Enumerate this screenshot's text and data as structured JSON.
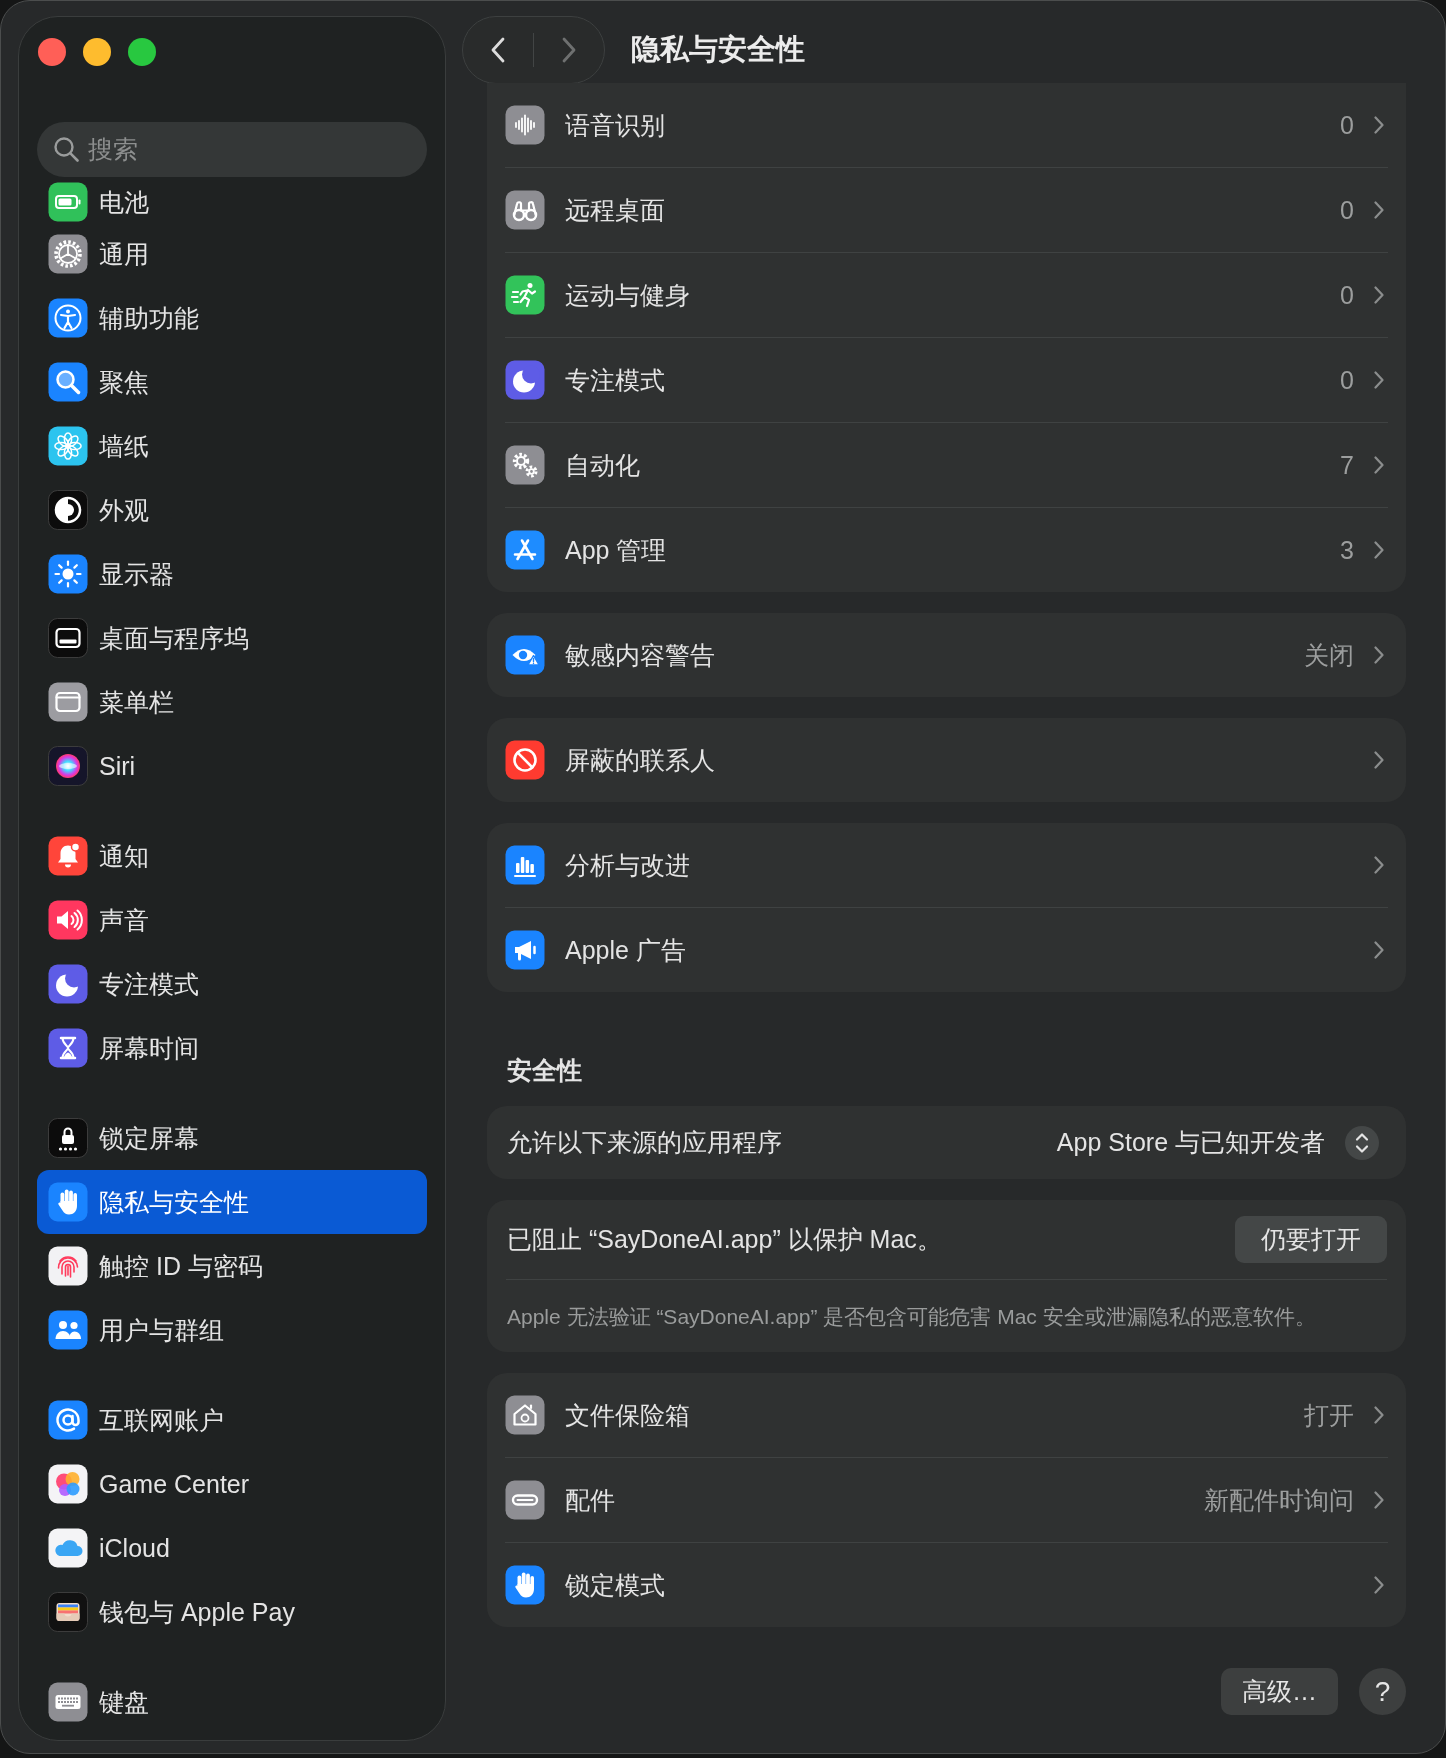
{
  "window": {
    "title": "隐私与安全性"
  },
  "navigation": {
    "back": {
      "disabled": false
    },
    "forward": {
      "disabled": true
    }
  },
  "sidebar": {
    "search": {
      "placeholder": "搜索"
    },
    "groups": [
      {
        "items": [
          {
            "label": "电池",
            "selected": false
          }
        ]
      },
      {
        "items": [
          {
            "label": "通用",
            "selected": false
          },
          {
            "label": "辅助功能",
            "selected": false
          },
          {
            "label": "聚焦",
            "selected": false
          },
          {
            "label": "墙纸",
            "selected": false
          },
          {
            "label": "外观",
            "selected": false
          },
          {
            "label": "显示器",
            "selected": false
          },
          {
            "label": "桌面与程序坞",
            "selected": false
          },
          {
            "label": "菜单栏",
            "selected": false
          },
          {
            "label": "Siri",
            "selected": false
          }
        ]
      },
      {
        "items": [
          {
            "label": "通知",
            "selected": false
          },
          {
            "label": "声音",
            "selected": false
          },
          {
            "label": "专注模式",
            "selected": false
          },
          {
            "label": "屏幕时间",
            "selected": false
          }
        ]
      },
      {
        "items": [
          {
            "label": "锁定屏幕",
            "selected": false
          },
          {
            "label": "隐私与安全性",
            "selected": true
          },
          {
            "label": "触控 ID 与密码",
            "selected": false
          },
          {
            "label": "用户与群组",
            "selected": false
          }
        ]
      },
      {
        "items": [
          {
            "label": "互联网账户",
            "selected": false
          },
          {
            "label": "Game Center",
            "selected": false
          },
          {
            "label": "iCloud",
            "selected": false
          },
          {
            "label": "钱包与 Apple Pay",
            "selected": false
          }
        ]
      },
      {
        "items": [
          {
            "label": "键盘",
            "selected": false
          }
        ]
      }
    ]
  },
  "content": [
    {
      "kind": "list",
      "rows": [
        {
          "label": "语音识别",
          "value": "0"
        },
        {
          "label": "远程桌面",
          "value": "0"
        },
        {
          "label": "运动与健身",
          "value": "0"
        },
        {
          "label": "专注模式",
          "value": "0"
        },
        {
          "label": "自动化",
          "value": "7"
        },
        {
          "label": "App 管理",
          "value": "3"
        }
      ]
    },
    {
      "kind": "list",
      "rows": [
        {
          "label": "敏感内容警告",
          "value": "关闭"
        }
      ]
    },
    {
      "kind": "list",
      "rows": [
        {
          "label": "屏蔽的联系人"
        }
      ]
    },
    {
      "kind": "list",
      "rows": [
        {
          "label": "分析与改进"
        },
        {
          "label": "Apple 广告"
        }
      ]
    },
    {
      "kind": "heading",
      "text": "安全性"
    },
    {
      "kind": "popup",
      "label": "允许以下来源的应用程序",
      "value": "App Store 与已知开发者"
    },
    {
      "kind": "notice",
      "message": "已阻止 “SayDoneAI.app” 以保护 Mac。",
      "button": "仍要打开",
      "note": "Apple 无法验证 “SayDoneAI.app” 是否包含可能危害 Mac 安全或泄漏隐私的恶意软件。"
    },
    {
      "kind": "list",
      "rows": [
        {
          "label": "文件保险箱",
          "value": "打开"
        },
        {
          "label": "配件",
          "value": "新配件时询问"
        },
        {
          "label": "锁定模式"
        }
      ]
    }
  ],
  "footer": {
    "advanced_button": "高级…",
    "help_button": "?"
  }
}
